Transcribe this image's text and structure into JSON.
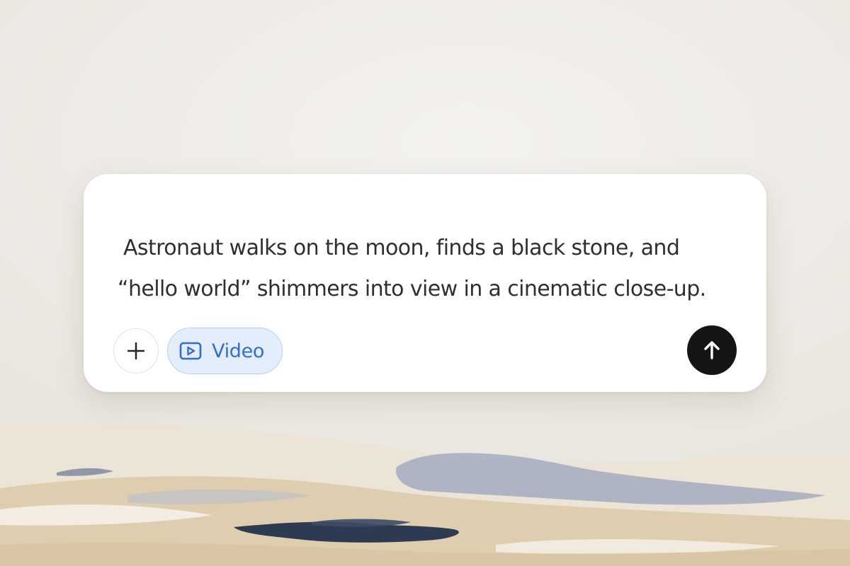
{
  "composer": {
    "prompt_lines": [
      "Astronaut walks on the moon, finds a black stone, and",
      "“hello world” shimmers into view in a cinematic close-up."
    ],
    "add_button": {
      "icon": "plus-icon"
    },
    "mode_chip": {
      "icon": "video-play-icon",
      "label": "Video"
    },
    "send_button": {
      "icon": "arrow-up-icon"
    }
  },
  "colors": {
    "chip_background": "#e3edfb",
    "chip_border": "#b9d0ef",
    "chip_text": "#2f6fcf",
    "send_button": "#151515",
    "prompt_text": "#2f2f2f"
  }
}
